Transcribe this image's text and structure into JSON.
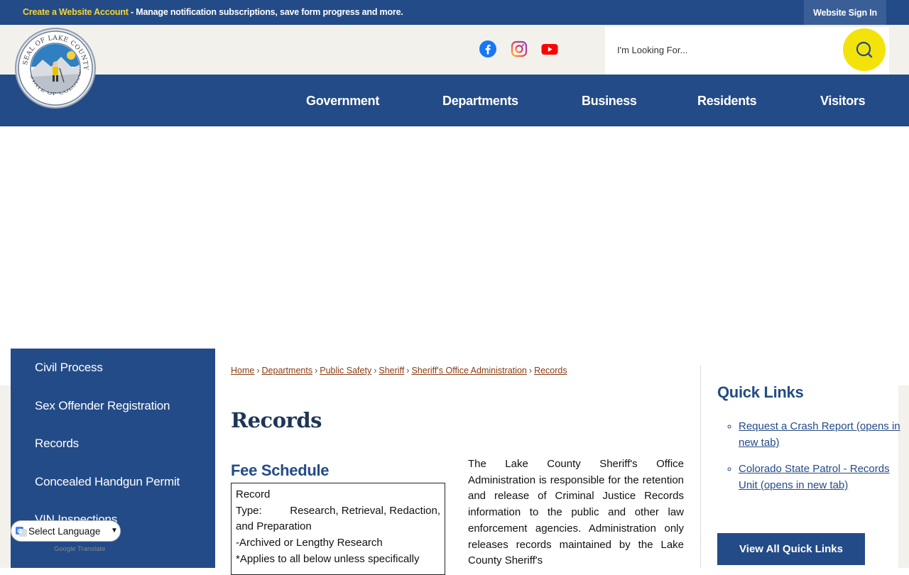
{
  "topbar": {
    "create_account": "Create a Website Account",
    "message": " - Manage notification subscriptions, save form progress and more.",
    "sign_in": "Website Sign In"
  },
  "header": {
    "social": [
      "facebook-icon",
      "instagram-icon",
      "youtube-icon"
    ],
    "search_placeholder": "I'm Looking For..."
  },
  "nav": {
    "items": [
      "Government",
      "Departments",
      "Business",
      "Residents",
      "Visitors"
    ]
  },
  "sidebar": {
    "items": [
      "Civil Process",
      "Sex Offender Registration",
      "Records",
      "Concealed Handgun Permit",
      "VIN Inspections"
    ]
  },
  "breadcrumb": {
    "items": [
      "Home",
      "Departments",
      "Public Safety",
      "Sheriff",
      "Sheriff's Office Administration",
      "Records"
    ]
  },
  "page": {
    "title": "Records",
    "fee_heading": "Fee Schedule",
    "fee_table": {
      "line1": "Record",
      "type_label": "Type:",
      "type_value": "Research, Retrieval, Redaction,",
      "line3": "and Preparation",
      "line4": "-Archived or Lengthy Research",
      "line5": "*Applies to all below unless specifically"
    },
    "paragraph": "The Lake County Sheriff's Office Administration is responsible for the retention and release of Criminal Justice Records information to the public and other law enforcement agencies. Administration only releases records maintained by the Lake County Sheriff's"
  },
  "quick_links": {
    "heading": "Quick Links",
    "links": [
      "Request a Crash Report (opens in new tab)",
      "Colorado State Patrol - Records Unit (opens in new tab)"
    ],
    "view_all": "View All Quick Links"
  },
  "translate": {
    "label": "Select Language",
    "powered_by": "Google Translate"
  },
  "colors": {
    "brand_blue": "#234b87",
    "accent_yellow": "#f3e30a",
    "link_brown": "#8a3b12"
  }
}
